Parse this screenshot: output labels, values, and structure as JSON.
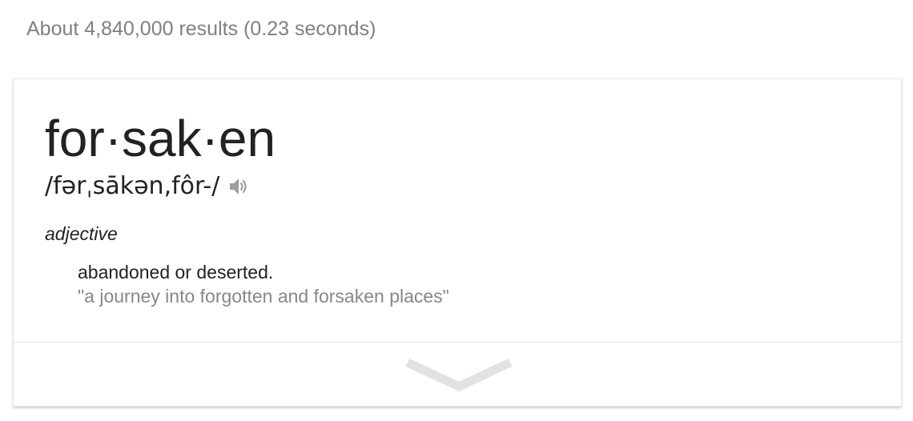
{
  "results": {
    "stats": "About 4,840,000 results (0.23 seconds)"
  },
  "dictionary": {
    "headword": "for·sak·en",
    "pronunciation": "/fərˌsākən,fôr-/",
    "speaker_icon": "speaker-icon",
    "part_of_speech": "adjective",
    "definition": "abandoned or deserted.",
    "example": "\"a journey into forgotten and forsaken places\"",
    "expand_icon": "chevron-down-icon"
  },
  "colors": {
    "text": "#222222",
    "muted": "#808080",
    "example": "#878787",
    "icon": "#9e9e9e",
    "chevron": "#e0e0e0"
  }
}
